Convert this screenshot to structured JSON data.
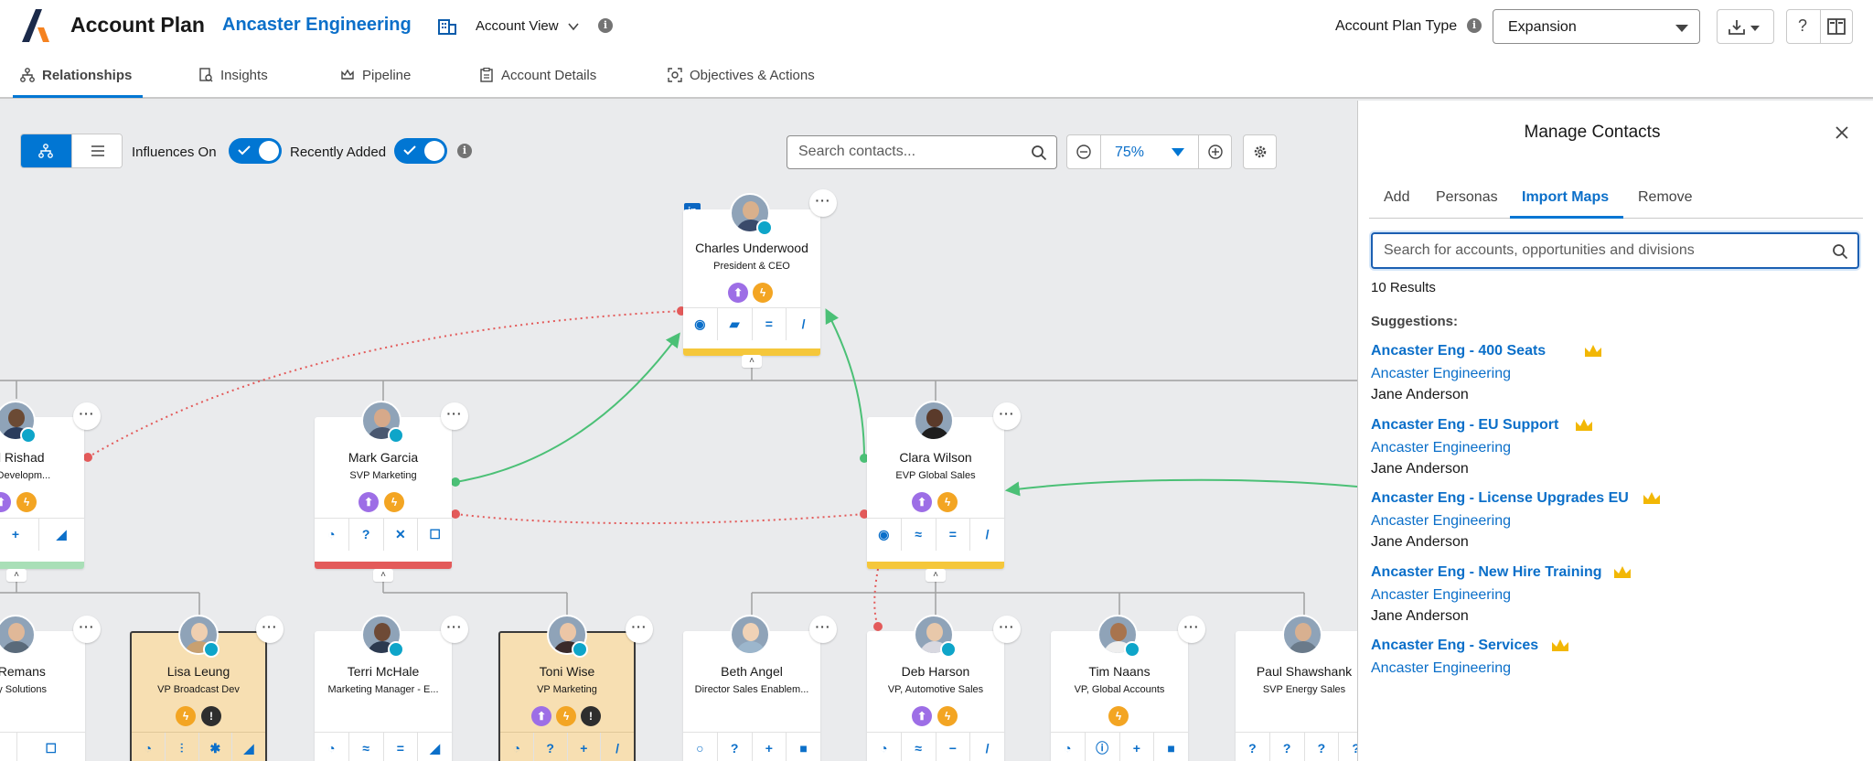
{
  "header": {
    "app_title": "Account Plan",
    "account_name": "Ancaster Engineering",
    "view_label": "Account View",
    "plan_type_label": "Account Plan Type",
    "plan_type_value": "Expansion"
  },
  "tabs": [
    {
      "label": "Relationships",
      "icon": "hierarchy-icon",
      "active": true
    },
    {
      "label": "Insights",
      "icon": "insights-icon"
    },
    {
      "label": "Pipeline",
      "icon": "crown-icon"
    },
    {
      "label": "Account Details",
      "icon": "clipboard-icon"
    },
    {
      "label": "Objectives & Actions",
      "icon": "target-icon"
    }
  ],
  "toolbar": {
    "influences_label": "Influences On",
    "recently_added_label": "Recently Added",
    "search_placeholder": "Search contacts...",
    "zoom_value": "75%"
  },
  "cards": [
    {
      "name": "Charles Underwood",
      "title": "President & CEO"
    },
    {
      "name": "ad Rishad",
      "title": "uct Developm..."
    },
    {
      "name": "Mark Garcia",
      "title": "SVP Marketing"
    },
    {
      "name": "Clara Wilson",
      "title": "EVP Global Sales"
    },
    {
      "name": "e Remans",
      "title": "stry Solutions"
    },
    {
      "name": "Lisa Leung",
      "title": "VP Broadcast Dev"
    },
    {
      "name": "Terri McHale",
      "title": "Marketing Manager - E..."
    },
    {
      "name": "Toni Wise",
      "title": "VP Marketing"
    },
    {
      "name": "Beth Angel",
      "title": "Director Sales Enablem..."
    },
    {
      "name": "Deb Harson",
      "title": "VP, Automotive Sales"
    },
    {
      "name": "Tim Naans",
      "title": "VP, Global Accounts"
    },
    {
      "name": "Paul Shawshank",
      "title": "SVP Energy Sales"
    }
  ],
  "panel": {
    "title": "Manage Contacts",
    "tabs": [
      "Add",
      "Personas",
      "Import Maps",
      "Remove"
    ],
    "active_tab": "Import Maps",
    "search_placeholder": "Search for accounts, opportunities and divisions",
    "results_count": "10 Results",
    "suggestions_label": "Suggestions:",
    "suggestions": [
      {
        "name": "Ancaster Eng - 400 Seats",
        "account": "Ancaster Engineering",
        "owner": "Jane Anderson"
      },
      {
        "name": "Ancaster Eng - EU Support",
        "account": "Ancaster Engineering",
        "owner": "Jane Anderson"
      },
      {
        "name": "Ancaster Eng - License Upgrades EU",
        "account": "Ancaster Engineering",
        "owner": "Jane Anderson"
      },
      {
        "name": "Ancaster Eng - New Hire Training",
        "account": "Ancaster Engineering",
        "owner": "Jane Anderson"
      },
      {
        "name": "Ancaster Eng - Services",
        "account": "Ancaster Engineering",
        "owner": ""
      }
    ]
  },
  "colors": {
    "brand_blue": "#0176d3",
    "link_blue": "#0b6fc9",
    "positive_green": "#4bc076",
    "negative_red": "#e35a5a",
    "highlight_card": "#f7dfb2",
    "crown_gold": "#f2b705"
  }
}
